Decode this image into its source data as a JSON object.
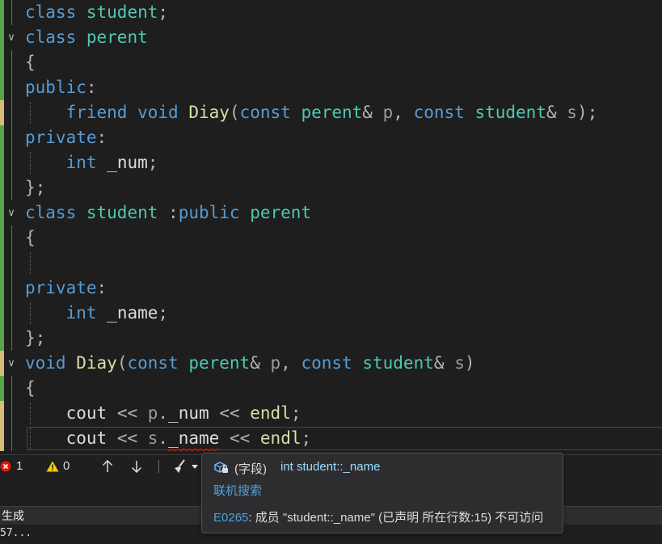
{
  "editor": {
    "lines": [
      {
        "fold": "",
        "indent": false,
        "bar": "green",
        "tokens": [
          [
            "kw",
            "class"
          ],
          [
            "sp",
            " "
          ],
          [
            "ty",
            "student"
          ],
          [
            "pu",
            ";"
          ]
        ]
      },
      {
        "fold": "v",
        "indent": false,
        "bar": "green",
        "tokens": [
          [
            "kw",
            "class"
          ],
          [
            "sp",
            " "
          ],
          [
            "ty",
            "perent"
          ]
        ]
      },
      {
        "fold": "",
        "indent": false,
        "bar": "green",
        "tokens": [
          [
            "pu",
            "{"
          ]
        ]
      },
      {
        "fold": "",
        "indent": false,
        "bar": "green",
        "tokens": [
          [
            "kw",
            "public"
          ],
          [
            "pu",
            ":"
          ]
        ]
      },
      {
        "fold": "",
        "indent": true,
        "bar": "yellow",
        "tokens": [
          [
            "sp",
            "    "
          ],
          [
            "kw",
            "friend"
          ],
          [
            "sp",
            " "
          ],
          [
            "kw",
            "void"
          ],
          [
            "sp",
            " "
          ],
          [
            "fn",
            "Diay"
          ],
          [
            "pu",
            "("
          ],
          [
            "kw",
            "const"
          ],
          [
            "sp",
            " "
          ],
          [
            "ty",
            "perent"
          ],
          [
            "pu",
            "&"
          ],
          [
            "sp",
            " "
          ],
          [
            "pr",
            "p"
          ],
          [
            "pu",
            ","
          ],
          [
            "sp",
            " "
          ],
          [
            "kw",
            "const"
          ],
          [
            "sp",
            " "
          ],
          [
            "ty",
            "student"
          ],
          [
            "pu",
            "&"
          ],
          [
            "sp",
            " "
          ],
          [
            "pr",
            "s"
          ],
          [
            "pu",
            ");"
          ]
        ]
      },
      {
        "fold": "",
        "indent": false,
        "bar": "green",
        "tokens": [
          [
            "kw",
            "private"
          ],
          [
            "pu",
            ":"
          ]
        ]
      },
      {
        "fold": "",
        "indent": true,
        "bar": "green",
        "tokens": [
          [
            "sp",
            "    "
          ],
          [
            "kw",
            "int"
          ],
          [
            "sp",
            " "
          ],
          [
            "id",
            "_num"
          ],
          [
            "pu",
            ";"
          ]
        ]
      },
      {
        "fold": "",
        "indent": false,
        "bar": "green",
        "tokens": [
          [
            "pu",
            "};"
          ]
        ]
      },
      {
        "fold": "v",
        "indent": false,
        "bar": "green",
        "tokens": [
          [
            "kw",
            "class"
          ],
          [
            "sp",
            " "
          ],
          [
            "ty",
            "student"
          ],
          [
            "sp",
            " "
          ],
          [
            "pu",
            ":"
          ],
          [
            "kw",
            "public"
          ],
          [
            "sp",
            " "
          ],
          [
            "ty",
            "perent"
          ]
        ]
      },
      {
        "fold": "",
        "indent": false,
        "bar": "green",
        "tokens": [
          [
            "pu",
            "{"
          ]
        ]
      },
      {
        "fold": "",
        "indent": true,
        "bar": "green",
        "tokens": []
      },
      {
        "fold": "",
        "indent": false,
        "bar": "green",
        "tokens": [
          [
            "kw",
            "private"
          ],
          [
            "pu",
            ":"
          ]
        ]
      },
      {
        "fold": "",
        "indent": true,
        "bar": "green",
        "tokens": [
          [
            "sp",
            "    "
          ],
          [
            "kw",
            "int"
          ],
          [
            "sp",
            " "
          ],
          [
            "id",
            "_name"
          ],
          [
            "pu",
            ";"
          ]
        ]
      },
      {
        "fold": "",
        "indent": false,
        "bar": "green",
        "tokens": [
          [
            "pu",
            "};"
          ]
        ]
      },
      {
        "fold": "v",
        "indent": false,
        "bar": "yellow",
        "tokens": [
          [
            "kw",
            "void"
          ],
          [
            "sp",
            " "
          ],
          [
            "fn",
            "Diay"
          ],
          [
            "pu",
            "("
          ],
          [
            "kw",
            "const"
          ],
          [
            "sp",
            " "
          ],
          [
            "ty",
            "perent"
          ],
          [
            "pu",
            "&"
          ],
          [
            "sp",
            " "
          ],
          [
            "pr",
            "p"
          ],
          [
            "pu",
            ","
          ],
          [
            "sp",
            " "
          ],
          [
            "kw",
            "const"
          ],
          [
            "sp",
            " "
          ],
          [
            "ty",
            "student"
          ],
          [
            "pu",
            "&"
          ],
          [
            "sp",
            " "
          ],
          [
            "pr",
            "s"
          ],
          [
            "pu",
            ")"
          ]
        ]
      },
      {
        "fold": "",
        "indent": false,
        "bar": "green",
        "tokens": [
          [
            "pu",
            "{"
          ]
        ]
      },
      {
        "fold": "",
        "indent": true,
        "bar": "yellow",
        "tokens": [
          [
            "sp",
            "    "
          ],
          [
            "id",
            "cout"
          ],
          [
            "sp",
            " "
          ],
          [
            "pu",
            "<<"
          ],
          [
            "sp",
            " "
          ],
          [
            "pr",
            "p"
          ],
          [
            "pu",
            "."
          ],
          [
            "id",
            "_num"
          ],
          [
            "sp",
            " "
          ],
          [
            "pu",
            "<<"
          ],
          [
            "sp",
            " "
          ],
          [
            "fn",
            "endl"
          ],
          [
            "pu",
            ";"
          ]
        ]
      },
      {
        "fold": "",
        "indent": true,
        "bar": "yellow",
        "tokens": [
          [
            "sp",
            "    "
          ],
          [
            "id",
            "cout"
          ],
          [
            "sp",
            " "
          ],
          [
            "pu",
            "<<"
          ],
          [
            "sp",
            " "
          ],
          [
            "pr",
            "s"
          ],
          [
            "pu",
            "."
          ],
          [
            "err",
            "_name"
          ],
          [
            "sp",
            " "
          ],
          [
            "pu",
            "<<"
          ],
          [
            "sp",
            " "
          ],
          [
            "fn",
            "endl"
          ],
          [
            "pu",
            ";"
          ]
        ]
      }
    ]
  },
  "statusbar": {
    "error_count": "1",
    "warning_count": "0"
  },
  "panel": {
    "tab_label": "生成",
    "output_text": "57..."
  },
  "tooltip": {
    "kind": "(字段)",
    "signature": "int student::_name",
    "search_link": "联机搜索",
    "error_code": "E0265",
    "error_message": ": 成员 \"student::_name\" (已声明 所在行数:15) 不可访问"
  },
  "colors": {
    "keyword": "#569cd6",
    "type": "#4ec9b0",
    "function": "#dcdcaa",
    "bar_green": "#57a64a",
    "bar_yellow": "#d7ba7d",
    "error": "#e51400",
    "link": "#4ca3e0"
  }
}
